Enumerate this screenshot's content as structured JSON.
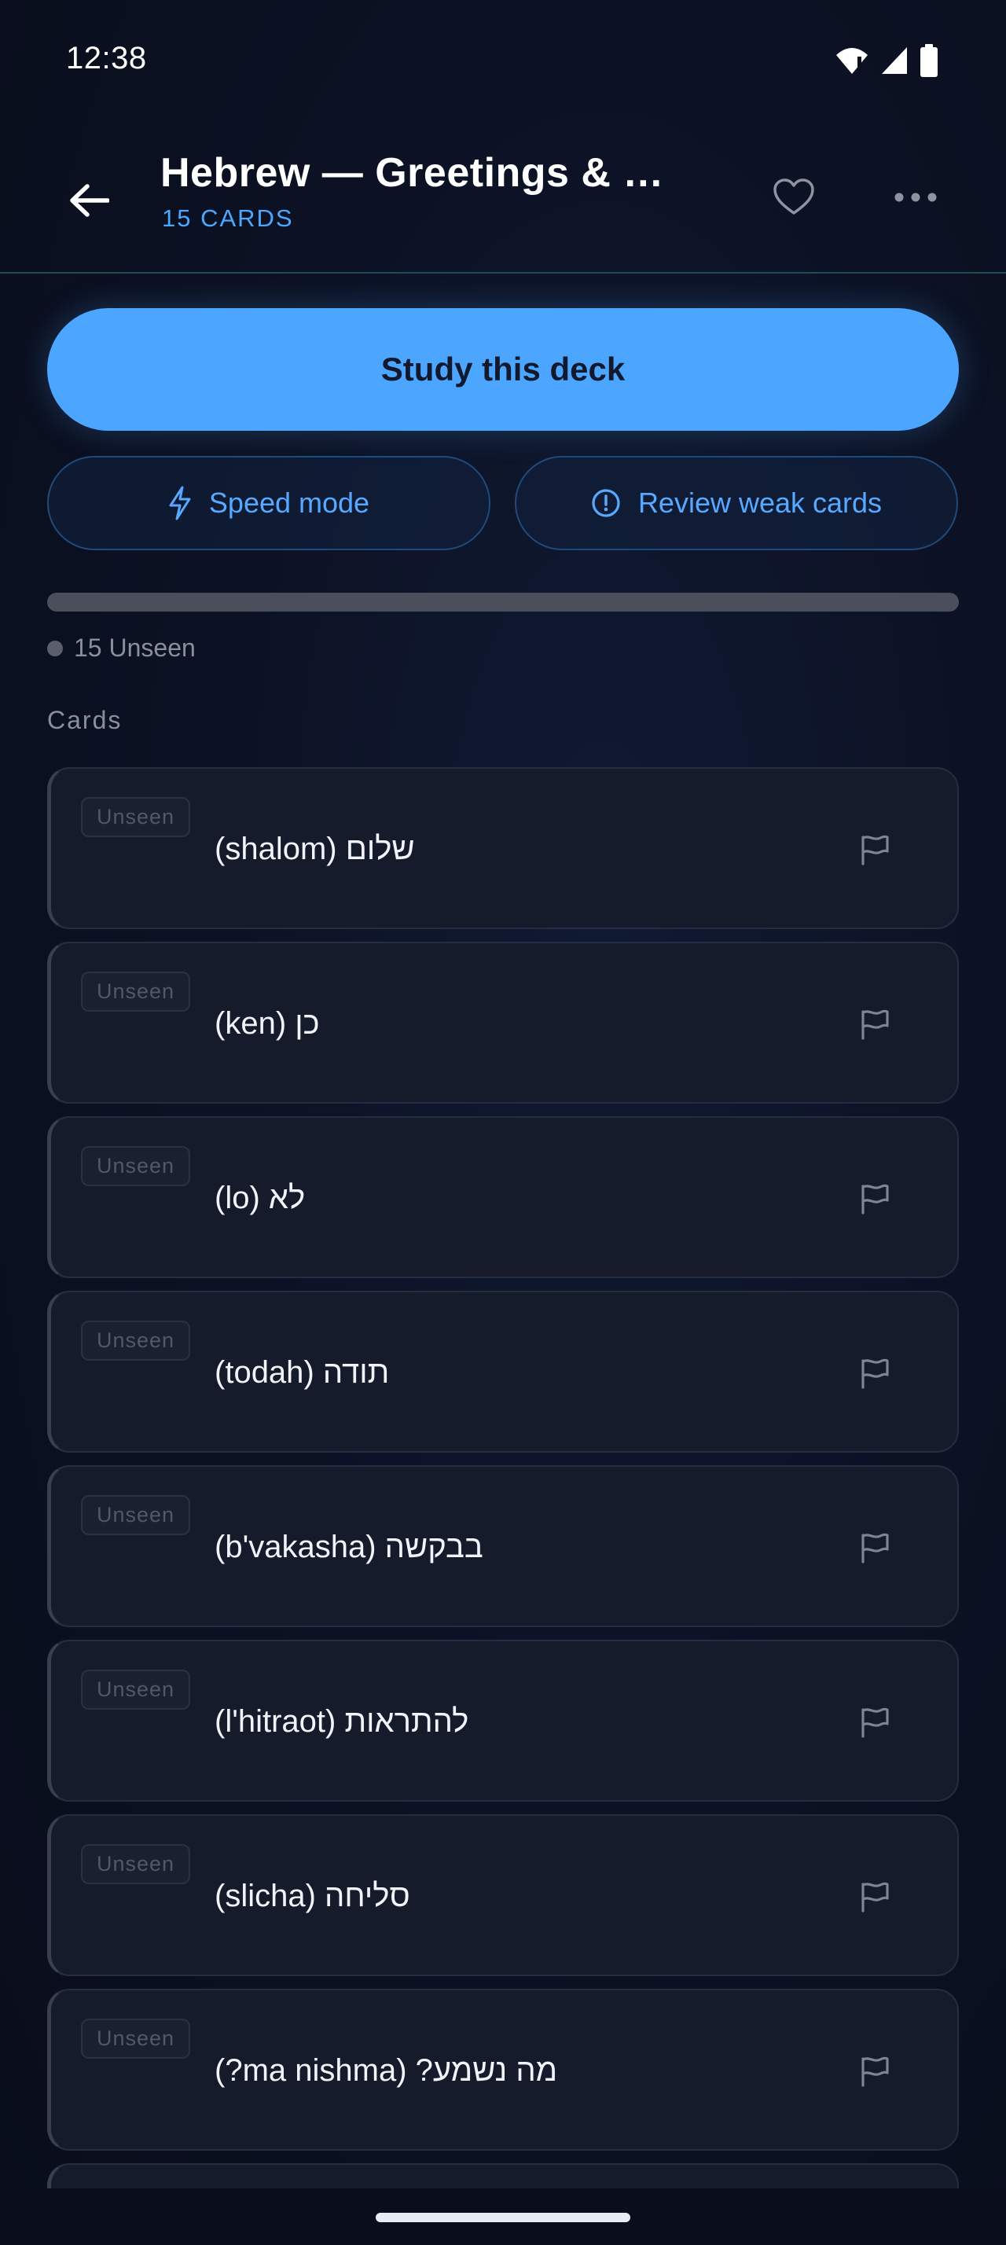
{
  "status_bar": {
    "time": "12:38",
    "icons": [
      "wifi-alert-icon",
      "signal-icon",
      "battery-icon"
    ]
  },
  "header": {
    "title": "Hebrew — Greetings & …",
    "card_count": "15 CARDS",
    "icons": {
      "back": "arrow-left-icon",
      "favorite": "heart-outline-icon",
      "more": "more-horizontal-icon"
    }
  },
  "actions": {
    "study": "Study this deck",
    "speed_mode": "Speed mode",
    "review_weak": "Review weak cards"
  },
  "progress": {
    "seen_fraction": 0,
    "legend": "15 Unseen"
  },
  "section": {
    "cards_label": "Cards"
  },
  "cards": [
    {
      "status": "Unseen",
      "term": "שלום (shalom)"
    },
    {
      "status": "Unseen",
      "term": "כן (ken)"
    },
    {
      "status": "Unseen",
      "term": "לא (lo)"
    },
    {
      "status": "Unseen",
      "term": "תודה (todah)"
    },
    {
      "status": "Unseen",
      "term": "בבקשה (b'vakasha)"
    },
    {
      "status": "Unseen",
      "term": "להתראות (l'hitraot)"
    },
    {
      "status": "Unseen",
      "term": "סליחה (slicha)"
    },
    {
      "status": "Unseen",
      "term": "מה נשמע? (ma nishma?)"
    }
  ],
  "colors": {
    "accent": "#4ca6ff",
    "background": "#0b0f1e",
    "card": "#151b2b",
    "muted_text": "#8a8f9c"
  }
}
